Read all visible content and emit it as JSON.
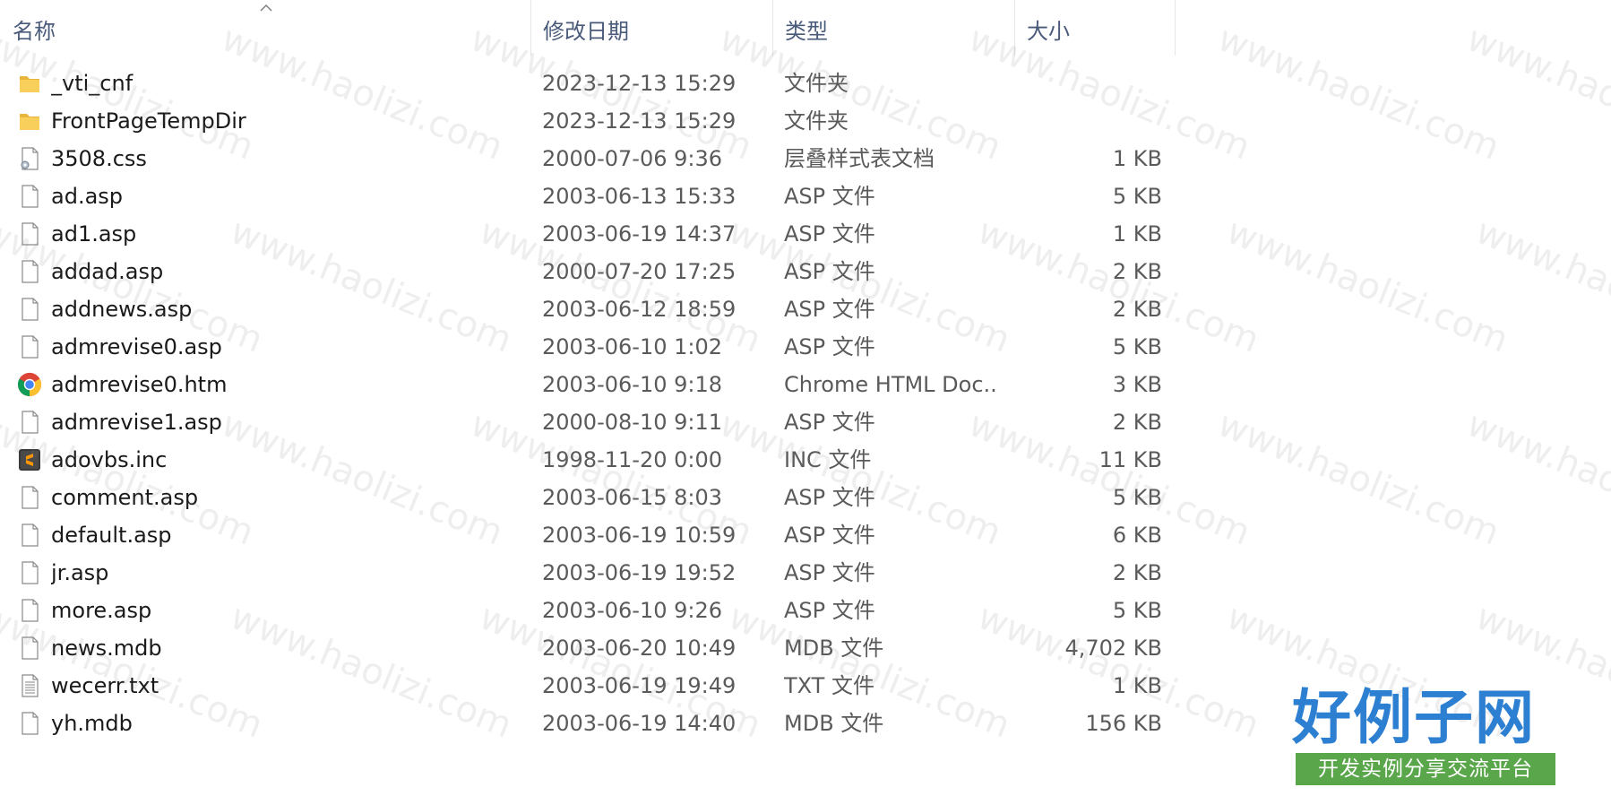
{
  "window": {
    "title": ""
  },
  "columns": {
    "name": "名称",
    "date": "修改日期",
    "type": "类型",
    "size": "大小"
  },
  "files": [
    {
      "icon": "folder-icon",
      "name": "_vti_cnf",
      "date": "2023-12-13 15:29",
      "type": "文件夹",
      "size": ""
    },
    {
      "icon": "folder-icon",
      "name": "FrontPageTempDir",
      "date": "2023-12-13 15:29",
      "type": "文件夹",
      "size": ""
    },
    {
      "icon": "css-file-icon",
      "name": "3508.css",
      "date": "2000-07-06 9:36",
      "type": "层叠样式表文档",
      "size": "1 KB"
    },
    {
      "icon": "file-icon",
      "name": "ad.asp",
      "date": "2003-06-13 15:33",
      "type": "ASP 文件",
      "size": "5 KB"
    },
    {
      "icon": "file-icon",
      "name": "ad1.asp",
      "date": "2003-06-19 14:37",
      "type": "ASP 文件",
      "size": "1 KB"
    },
    {
      "icon": "file-icon",
      "name": "addad.asp",
      "date": "2000-07-20 17:25",
      "type": "ASP 文件",
      "size": "2 KB"
    },
    {
      "icon": "file-icon",
      "name": "addnews.asp",
      "date": "2003-06-12 18:59",
      "type": "ASP 文件",
      "size": "2 KB"
    },
    {
      "icon": "file-icon",
      "name": "admrevise0.asp",
      "date": "2003-06-10 1:02",
      "type": "ASP 文件",
      "size": "5 KB"
    },
    {
      "icon": "chrome-icon",
      "name": "admrevise0.htm",
      "date": "2003-06-10 9:18",
      "type": "Chrome HTML Doc...",
      "size": "3 KB"
    },
    {
      "icon": "file-icon",
      "name": "admrevise1.asp",
      "date": "2000-08-10 9:11",
      "type": "ASP 文件",
      "size": "2 KB"
    },
    {
      "icon": "sublime-icon",
      "name": "adovbs.inc",
      "date": "1998-11-20 0:00",
      "type": "INC 文件",
      "size": "11 KB"
    },
    {
      "icon": "file-icon",
      "name": "comment.asp",
      "date": "2003-06-15 8:03",
      "type": "ASP 文件",
      "size": "5 KB"
    },
    {
      "icon": "file-icon",
      "name": "default.asp",
      "date": "2003-06-19 10:59",
      "type": "ASP 文件",
      "size": "6 KB"
    },
    {
      "icon": "file-icon",
      "name": "jr.asp",
      "date": "2003-06-19 19:52",
      "type": "ASP 文件",
      "size": "2 KB"
    },
    {
      "icon": "file-icon",
      "name": "more.asp",
      "date": "2003-06-10 9:26",
      "type": "ASP 文件",
      "size": "5 KB"
    },
    {
      "icon": "file-icon",
      "name": "news.mdb",
      "date": "2003-06-20 10:49",
      "type": "MDB 文件",
      "size": "4,702 KB"
    },
    {
      "icon": "text-file-icon",
      "name": "wecerr.txt",
      "date": "2003-06-19 19:49",
      "type": "TXT 文件",
      "size": "1 KB"
    },
    {
      "icon": "file-icon",
      "name": "yh.mdb",
      "date": "2003-06-19 14:40",
      "type": "MDB 文件",
      "size": "156 KB"
    }
  ],
  "watermark": {
    "text": "www.haolizi.com",
    "brand_title": "好例子网",
    "brand_subtitle": "开发实例分享交流平台",
    "brand_color": "#2d7fd1",
    "subtitle_bg": "#5aa64a"
  },
  "colors": {
    "folder": "#f4c542",
    "header_text": "#4a5a7a"
  }
}
